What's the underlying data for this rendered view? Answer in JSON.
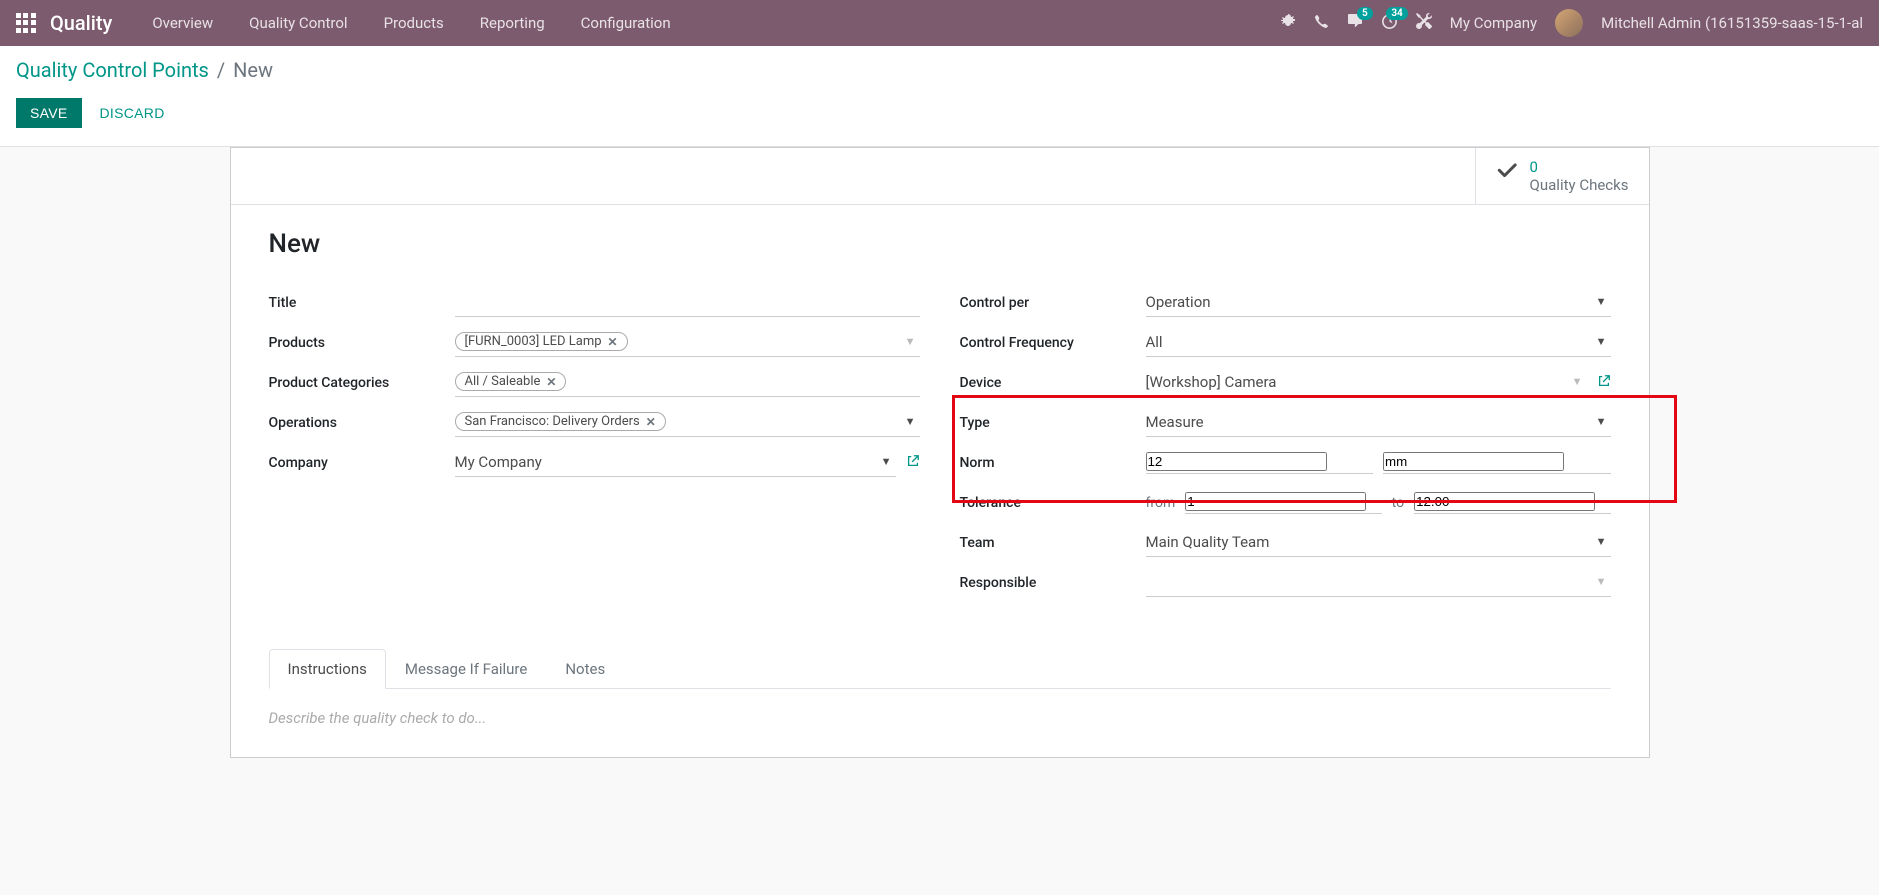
{
  "navbar": {
    "brand": "Quality",
    "menu": [
      "Overview",
      "Quality Control",
      "Products",
      "Reporting",
      "Configuration"
    ],
    "messages_badge": "5",
    "activities_badge": "34",
    "company": "My Company",
    "user": "Mitchell Admin (16151359-saas-15-1-al"
  },
  "breadcrumb": {
    "parent": "Quality Control Points",
    "current": "New"
  },
  "buttons": {
    "save": "SAVE",
    "discard": "DISCARD"
  },
  "stat_button": {
    "value": "0",
    "label": "Quality Checks"
  },
  "form": {
    "title": "New",
    "labels": {
      "title": "Title",
      "products": "Products",
      "product_categories": "Product Categories",
      "operations": "Operations",
      "company": "Company",
      "control_per": "Control per",
      "control_frequency": "Control Frequency",
      "device": "Device",
      "type": "Type",
      "norm": "Norm",
      "tolerance": "Tolerance",
      "team": "Team",
      "responsible": "Responsible"
    },
    "values": {
      "product_tag": "[FURN_0003] LED Lamp",
      "category_tag": "All / Saleable",
      "operation_tag": "San Francisco: Delivery Orders",
      "company": "My Company",
      "control_per": "Operation",
      "control_frequency": "All",
      "device": "[Workshop] Camera",
      "type": "Measure",
      "norm_value": "12",
      "norm_unit": "mm",
      "tolerance_from_label": "from",
      "tolerance_from": "1",
      "tolerance_to_label": "to",
      "tolerance_to": "12.00",
      "team": "Main Quality Team"
    },
    "tabs": [
      "Instructions",
      "Message If Failure",
      "Notes"
    ],
    "instructions_placeholder": "Describe the quality check to do..."
  }
}
